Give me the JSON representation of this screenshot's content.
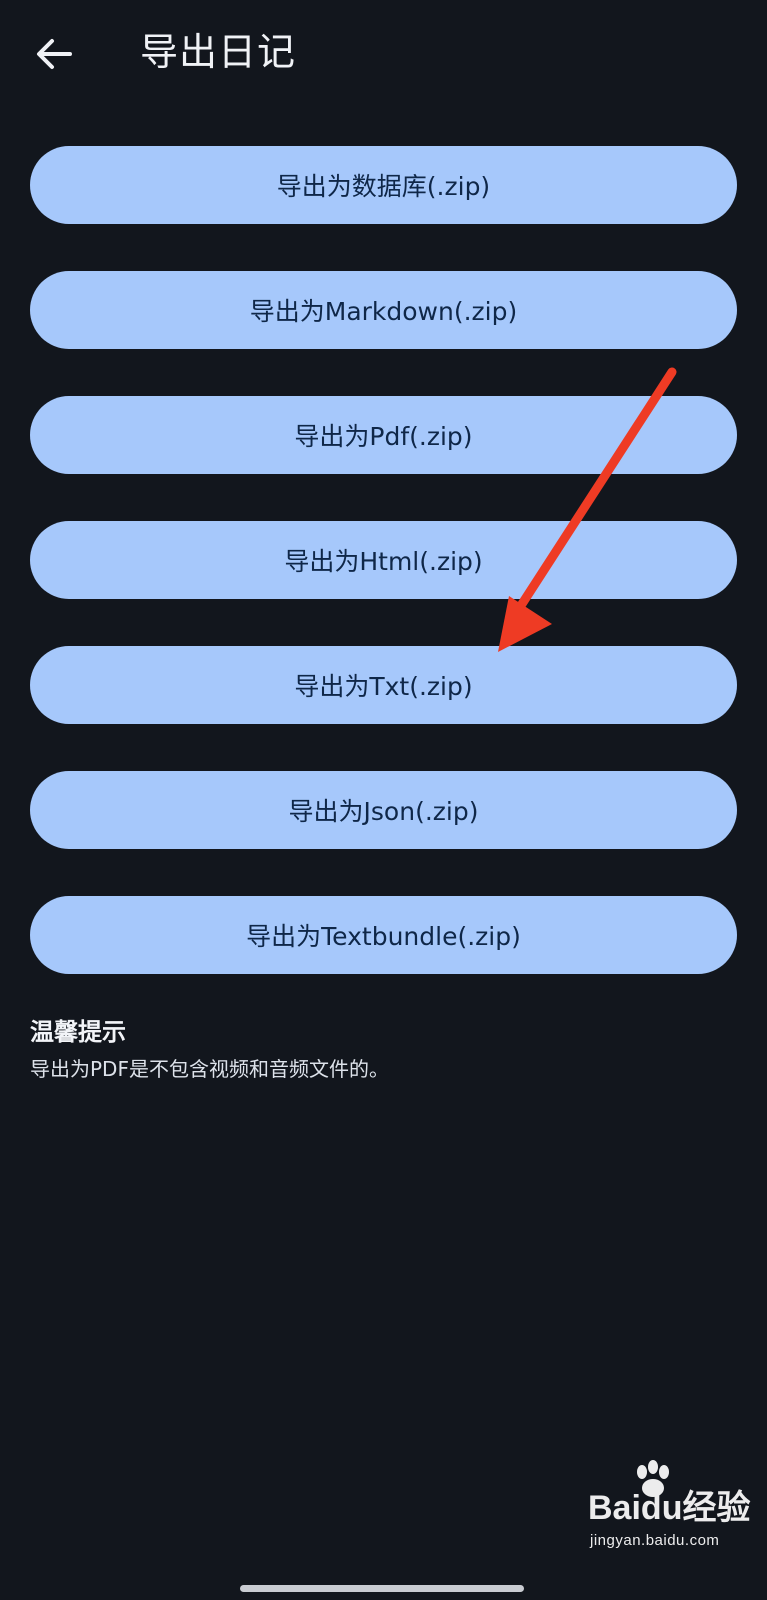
{
  "header": {
    "back_icon": "arrow-left-icon",
    "title": "导出日记"
  },
  "export_buttons": [
    {
      "label": "导出为数据库(.zip)"
    },
    {
      "label": "导出为Markdown(.zip)"
    },
    {
      "label": "导出为Pdf(.zip)"
    },
    {
      "label": "导出为Html(.zip)"
    },
    {
      "label": "导出为Txt(.zip)"
    },
    {
      "label": "导出为Json(.zip)"
    },
    {
      "label": "导出为Textbundle(.zip)"
    }
  ],
  "tip": {
    "title": "温馨提示",
    "text": "导出为PDF是不包含视频和音频文件的。"
  },
  "annotation": {
    "icon": "red-arrow-annotation-icon",
    "color": "#ee3b24",
    "points_to": "导出为Txt(.zip)"
  },
  "watermark": {
    "main_left": "Bai",
    "main_mid": "du",
    "main_right": "经验",
    "sub": "jingyan.baidu.com",
    "icon": "paw-icon"
  },
  "colors": {
    "background": "#12161d",
    "button_bg": "#a6c8fb",
    "button_text": "#0f2748"
  }
}
